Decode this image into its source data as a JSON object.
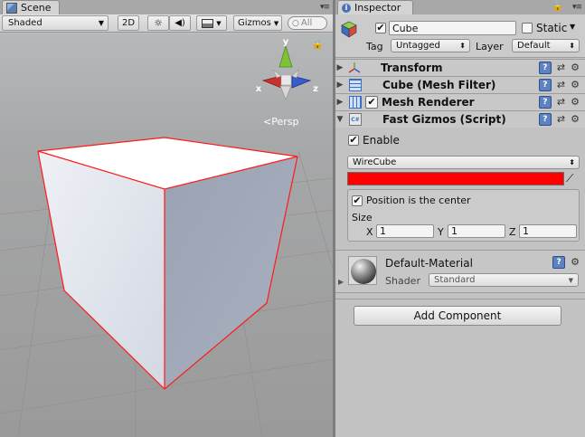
{
  "scene": {
    "tab_label": "Scene",
    "shading_mode": "Shaded",
    "mode_2d": "2D",
    "gizmos_label": "Gizmos",
    "search_placeholder": "All",
    "gizmo": {
      "y_label": "y",
      "x_label": "x",
      "z_label": "z",
      "view_label": "Persp"
    }
  },
  "inspector": {
    "tab_label": "Inspector",
    "object": {
      "name": "Cube",
      "active": true,
      "static_label": "Static",
      "static": false,
      "tag_label": "Tag",
      "tag_value": "Untagged",
      "layer_label": "Layer",
      "layer_value": "Default"
    },
    "components": [
      {
        "title": "Transform",
        "has_checkbox": false,
        "expanded": false
      },
      {
        "title": "Cube (Mesh Filter)",
        "has_checkbox": false,
        "expanded": false
      },
      {
        "title": "Mesh Renderer",
        "has_checkbox": true,
        "enabled": true,
        "expanded": false
      },
      {
        "title": "Fast Gizmos (Script)",
        "has_checkbox": false,
        "expanded": true
      }
    ],
    "fast_gizmos": {
      "enable_label": "Enable",
      "enable_checked": true,
      "shape_value": "WireCube",
      "color": "#ff0000",
      "position_center_label": "Position is the center",
      "position_center_checked": true,
      "size_label": "Size",
      "size": {
        "x_label": "X",
        "x": "1",
        "y_label": "Y",
        "y": "1",
        "z_label": "Z",
        "z": "1"
      }
    },
    "material": {
      "name": "Default-Material",
      "shader_label": "Shader",
      "shader_value": "Standard"
    },
    "add_component_label": "Add Component"
  },
  "colors": {
    "wire": "#ff0000",
    "axis_x": "#c8322c",
    "axis_y": "#7ec23a",
    "axis_z": "#3a5cc8",
    "selection_blue": "#3d6fc9"
  }
}
